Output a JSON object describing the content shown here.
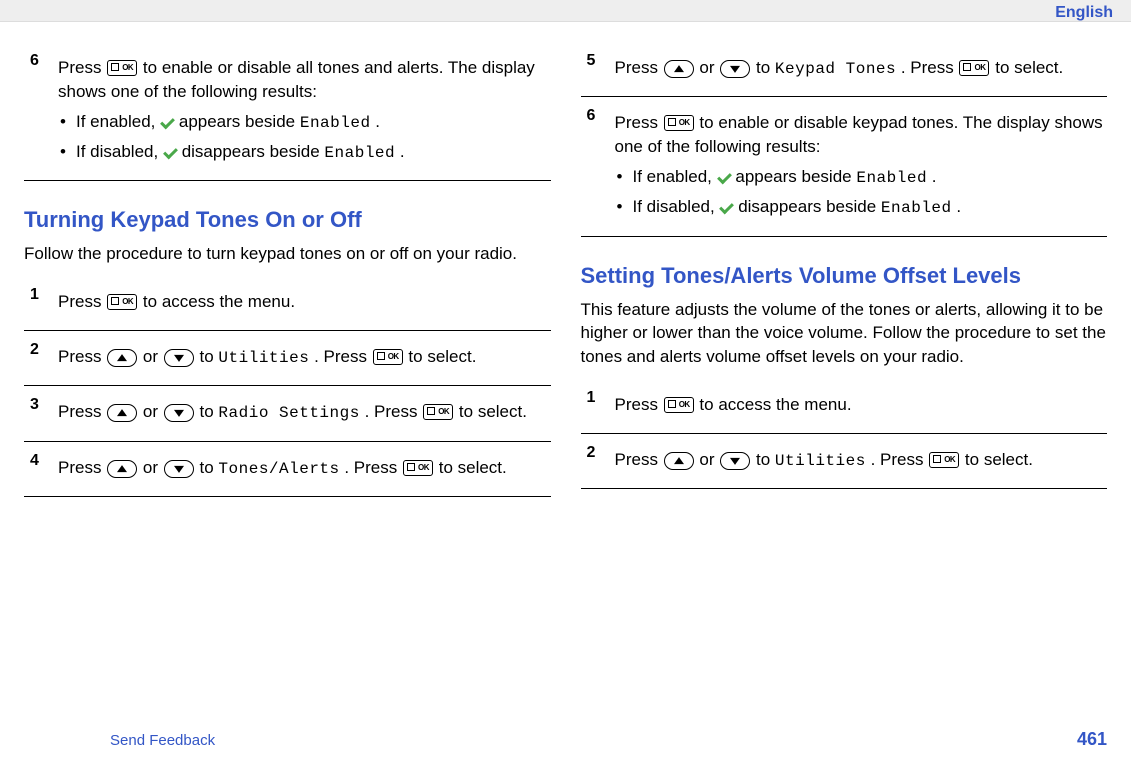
{
  "header": {
    "language": "English"
  },
  "left": {
    "step6": {
      "num": "6",
      "line1_a": "Press ",
      "line1_b": " to enable or disable all tones and alerts. The display shows one of the following results:",
      "b1_a": "If enabled, ",
      "b1_b": " appears beside ",
      "b1_c": "Enabled",
      "b1_d": ".",
      "b2_a": "If disabled, ",
      "b2_b": " disappears beside ",
      "b2_c": "Enabled",
      "b2_d": "."
    },
    "heading1": "Turning Keypad Tones On or Off",
    "intro1": "Follow the procedure to turn keypad tones on or off on your radio.",
    "s1": {
      "num": "1",
      "a": "Press ",
      "b": " to access the menu."
    },
    "s2": {
      "num": "2",
      "a": "Press ",
      "b": " or ",
      "c": " to ",
      "d": "Utilities",
      "e": ". Press ",
      "f": " to select."
    },
    "s3": {
      "num": "3",
      "a": "Press ",
      "b": " or ",
      "c": " to ",
      "d": "Radio Settings",
      "e": ". Press ",
      "f": " to select."
    },
    "s4": {
      "num": "4",
      "a": "Press ",
      "b": " or ",
      "c": " to ",
      "d": "Tones/Alerts",
      "e": ". Press ",
      "f": " to select."
    }
  },
  "right": {
    "s5": {
      "num": "5",
      "a": "Press ",
      "b": " or ",
      "c": " to ",
      "d": "Keypad Tones",
      "e": ". Press ",
      "f": " to select."
    },
    "s6": {
      "num": "6",
      "a": "Press ",
      "b": " to enable or disable keypad tones. The display shows one of the following results:",
      "b1_a": "If enabled, ",
      "b1_b": " appears beside ",
      "b1_c": "Enabled",
      "b1_d": ".",
      "b2_a": "If disabled, ",
      "b2_b": " disappears beside ",
      "b2_c": "Enabled",
      "b2_d": "."
    },
    "heading2": "Setting Tones/Alerts Volume Offset Levels",
    "intro2": "This feature adjusts the volume of the tones or alerts, allowing it to be higher or lower than the voice volume. Follow the procedure to set the tones and alerts volume offset levels on your radio.",
    "r1": {
      "num": "1",
      "a": "Press ",
      "b": " to access the menu."
    },
    "r2": {
      "num": "2",
      "a": "Press ",
      "b": " or ",
      "c": " to ",
      "d": "Utilities",
      "e": ". Press ",
      "f": " to select."
    }
  },
  "footer": {
    "feedback": "Send Feedback",
    "page": "461"
  }
}
